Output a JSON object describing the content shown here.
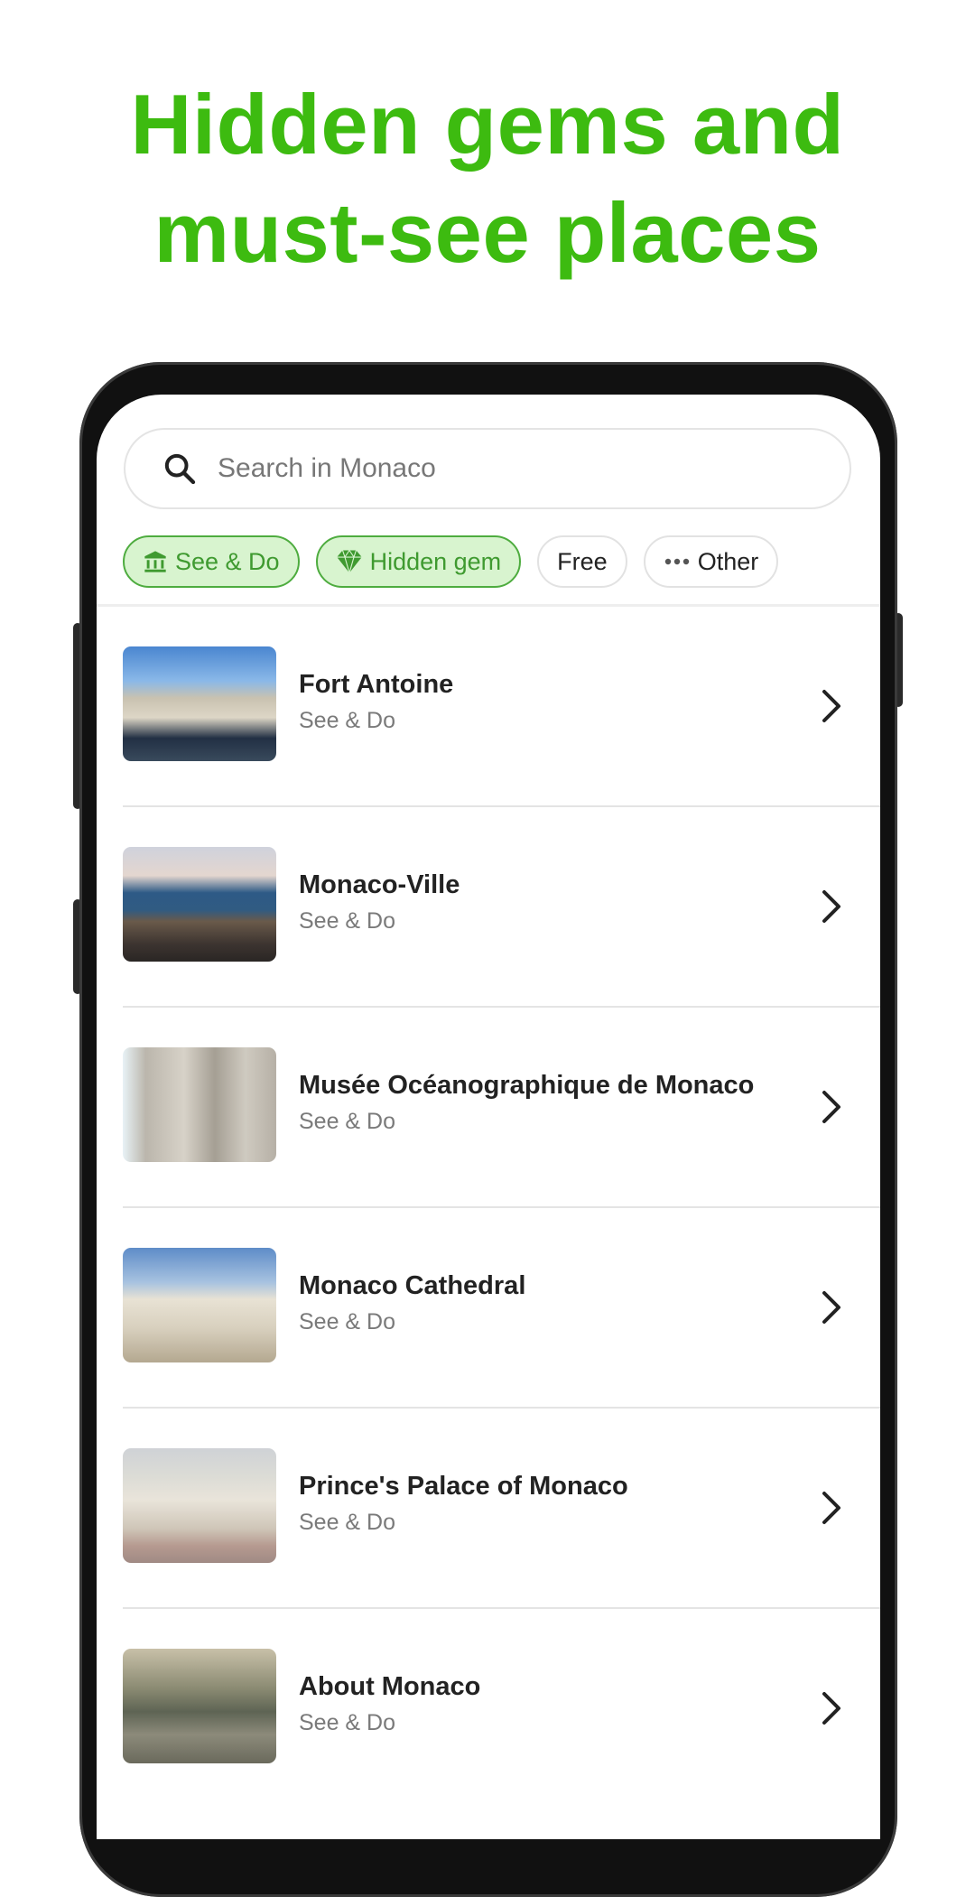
{
  "headline": {
    "line1": "Hidden gems and",
    "line2": "must-see places",
    "color": "#3dbb10"
  },
  "search": {
    "placeholder": "Search in Monaco",
    "value": "",
    "icon": "search-icon"
  },
  "filters": [
    {
      "label": "See & Do",
      "icon": "museum-icon",
      "active": true
    },
    {
      "label": "Hidden gem",
      "icon": "diamond-icon",
      "active": true
    },
    {
      "label": "Free",
      "icon": null,
      "active": false
    },
    {
      "label": "Other",
      "icon": "more-dots-icon",
      "active": false
    }
  ],
  "places": [
    {
      "title": "Fort Antoine",
      "category": "See & Do"
    },
    {
      "title": "Monaco-Ville",
      "category": "See & Do"
    },
    {
      "title": "Musée Océanographique de Monaco",
      "category": "See & Do"
    },
    {
      "title": "Monaco Cathedral",
      "category": "See & Do"
    },
    {
      "title": "Prince's Palace of Monaco",
      "category": "See & Do"
    },
    {
      "title": "About Monaco",
      "category": "See & Do"
    }
  ],
  "colors": {
    "accent": "#3dbb10",
    "chip_active_bg": "#d8f4cf",
    "chip_active_border": "#4eac3f",
    "chip_active_text": "#3f9a30"
  }
}
